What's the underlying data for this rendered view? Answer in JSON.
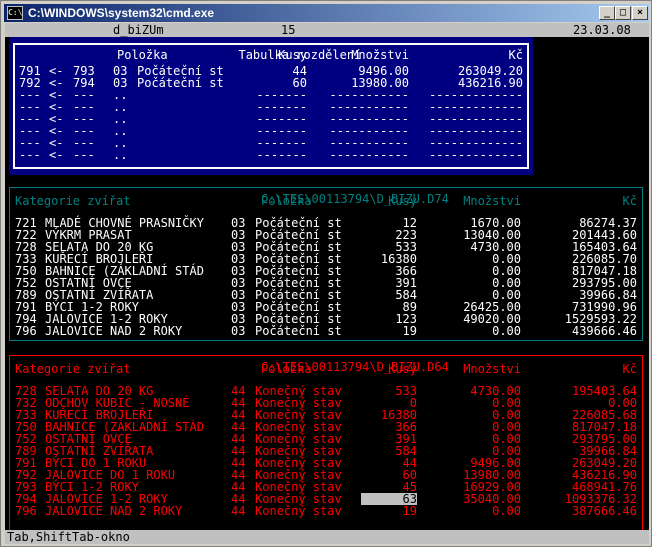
{
  "window": {
    "title": "C:\\WINDOWS\\system32\\cmd.exe",
    "icon": "cmd-icon",
    "minimize": "_",
    "maximize": "□",
    "close": "×"
  },
  "top_bar": {
    "program": "d_biZUm",
    "number": "15",
    "date": "23.03.08"
  },
  "panel1": {
    "title": "Tabulka rozdělení",
    "headers": {
      "item": "Položka",
      "count": "Kusy",
      "quantity": "Množstvi",
      "price": "Kč"
    },
    "rows": [
      {
        "a": "791",
        "arrow": "<-",
        "b": "793",
        "code": "03",
        "name": "Počáteční st",
        "count": "44",
        "qty": "9496.00",
        "price": "263049.20"
      },
      {
        "a": "792",
        "arrow": "<-",
        "b": "794",
        "code": "03",
        "name": "Počáteční st",
        "count": "60",
        "qty": "13980.00",
        "price": "436216.90"
      },
      {
        "a": "---",
        "arrow": "<-",
        "b": "---",
        "code": "..",
        "name": "",
        "count": "-------",
        "qty": "-----------",
        "price": "-------------"
      },
      {
        "a": "---",
        "arrow": "<-",
        "b": "---",
        "code": "..",
        "name": "",
        "count": "-------",
        "qty": "-----------",
        "price": "-------------"
      },
      {
        "a": "---",
        "arrow": "<-",
        "b": "---",
        "code": "..",
        "name": "",
        "count": "-------",
        "qty": "-----------",
        "price": "-------------"
      },
      {
        "a": "---",
        "arrow": "<-",
        "b": "---",
        "code": "..",
        "name": "",
        "count": "-------",
        "qty": "-----------",
        "price": "-------------"
      },
      {
        "a": "---",
        "arrow": "<-",
        "b": "---",
        "code": "..",
        "name": "",
        "count": "-------",
        "qty": "-----------",
        "price": "-------------"
      },
      {
        "a": "---",
        "arrow": "<-",
        "b": "---",
        "code": "..",
        "name": "",
        "count": "-------",
        "qty": "-----------",
        "price": "-------------"
      }
    ]
  },
  "panel2": {
    "title": "C:\\TES\\00113794\\D_BIZU.D74",
    "headers": {
      "category": "Kategorie zvířat",
      "item": "Položka",
      "count": "Kusy",
      "quantity": "Množstvi",
      "price": "Kč"
    },
    "rows": [
      {
        "id": "721",
        "name": "MLADÉ CHOVNÉ PRASNIČKY",
        "code": "03",
        "item": "Počáteční st",
        "count": "12",
        "qty": "1670.00",
        "price": "86274.37"
      },
      {
        "id": "722",
        "name": "VÝKRM PRASAT",
        "code": "03",
        "item": "Počáteční st",
        "count": "223",
        "qty": "13040.00",
        "price": "201443.60"
      },
      {
        "id": "728",
        "name": "SELATA DO 20 KG",
        "code": "03",
        "item": "Počáteční st",
        "count": "533",
        "qty": "4730.00",
        "price": "165403.64"
      },
      {
        "id": "733",
        "name": "KUŘECÍ BROJLEŘI",
        "code": "03",
        "item": "Počáteční st",
        "count": "16380",
        "qty": "0.00",
        "price": "226085.70"
      },
      {
        "id": "750",
        "name": "BAHNICE (ZÁKLADNÍ STÁD",
        "code": "03",
        "item": "Počáteční st",
        "count": "366",
        "qty": "0.00",
        "price": "817047.18"
      },
      {
        "id": "752",
        "name": "OSTATNÍ OVCE",
        "code": "03",
        "item": "Počáteční st",
        "count": "391",
        "qty": "0.00",
        "price": "293795.00"
      },
      {
        "id": "789",
        "name": "OSTATNÍ ZVÍŘATA",
        "code": "03",
        "item": "Počáteční st",
        "count": "584",
        "qty": "0.00",
        "price": "39966.84"
      },
      {
        "id": "791",
        "name": "BÝCI 1-2 ROKY",
        "code": "03",
        "item": "Počáteční st",
        "count": "89",
        "qty": "26425.00",
        "price": "731990.96"
      },
      {
        "id": "794",
        "name": "JALOVICE 1-2 ROKY",
        "code": "03",
        "item": "Počáteční st",
        "count": "123",
        "qty": "49020.00",
        "price": "1529593.22"
      },
      {
        "id": "796",
        "name": "JALOVICE NAD 2 ROKY",
        "code": "03",
        "item": "Počáteční st",
        "count": "19",
        "qty": "0.00",
        "price": "439666.46"
      }
    ]
  },
  "panel3": {
    "title": "C:\\TES\\00113794\\D_BIZU.D64",
    "headers": {
      "category": "Kategorie zvířat",
      "item": "Položka",
      "count": "Kusy",
      "quantity": "Množstvi",
      "price": "Kč"
    },
    "rows": [
      {
        "id": "728",
        "name": "SELATA DO 20 KG",
        "code": "44",
        "item": "Konečný stav",
        "count": "533",
        "qty": "4730.00",
        "price": "195403.64"
      },
      {
        "id": "732",
        "name": "ODCHOV KUBIC - NOSNÉ",
        "code": "44",
        "item": "Konečný stav",
        "count": "0",
        "qty": "0.00",
        "price": "0.00"
      },
      {
        "id": "733",
        "name": "KUŘECÍ BROJLEŘI",
        "code": "44",
        "item": "Konečný stav",
        "count": "16380",
        "qty": "0.00",
        "price": "226085.68"
      },
      {
        "id": "750",
        "name": "BAHNICE (ZÁKLADNÍ STÁD",
        "code": "44",
        "item": "Konečný stav",
        "count": "366",
        "qty": "0.00",
        "price": "817047.18"
      },
      {
        "id": "752",
        "name": "OSTATNÍ OVCE",
        "code": "44",
        "item": "Konečný stav",
        "count": "391",
        "qty": "0.00",
        "price": "293795.00"
      },
      {
        "id": "789",
        "name": "OSTATNÍ ZVÍŘATA",
        "code": "44",
        "item": "Konečný stav",
        "count": "584",
        "qty": "0.00",
        "price": "39966.84"
      },
      {
        "id": "791",
        "name": "BÝCI DO 1 ROKU",
        "code": "44",
        "item": "Konečný stav",
        "count": "44",
        "qty": "9496.00",
        "price": "263049.20"
      },
      {
        "id": "792",
        "name": "JALOVICE DO 1 ROKU",
        "code": "44",
        "item": "Konečný stav",
        "count": "60",
        "qty": "13980.00",
        "price": "436216.90"
      },
      {
        "id": "793",
        "name": "BÝCI 1-2 ROKY",
        "code": "44",
        "item": "Konečný stav",
        "count": "45",
        "qty": "16929.00",
        "price": "468941.76"
      },
      {
        "id": "794",
        "name": "JALOVICE 1-2 ROKY",
        "code": "44",
        "item": "Konečný stav",
        "count": "63",
        "qty": "35040.00",
        "price": "1093376.32"
      },
      {
        "id": "796",
        "name": "JALOVICE NAD 2 ROKY",
        "code": "44",
        "item": "Konečný stav",
        "count": "19",
        "qty": "0.00",
        "price": "387666.46"
      }
    ]
  },
  "status_bar": {
    "hint": "Tab,ShiftTab-okno"
  },
  "colors": {
    "panel1_bg": "#000080",
    "panel1_text": "#ffffff",
    "panel2_accent": "#008080",
    "panel2_text": "#ffffff",
    "panel3_accent": "#ff0000",
    "bar_bg": "#c0c0c0",
    "selection_bg": "#c0c0c0"
  }
}
